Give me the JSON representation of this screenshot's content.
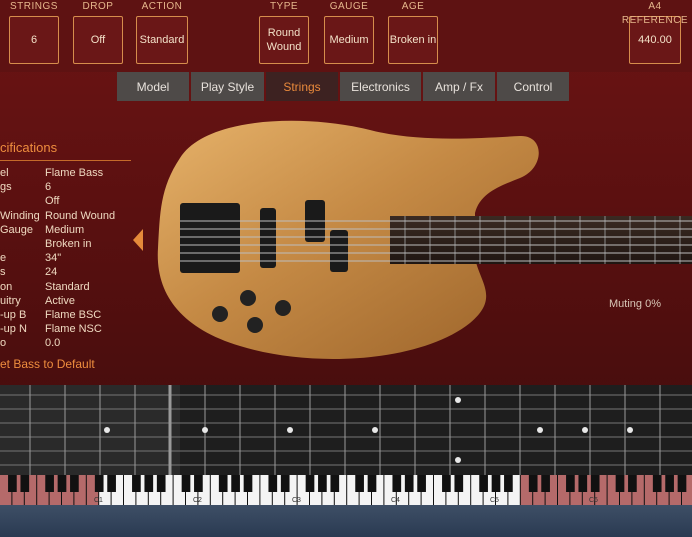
{
  "top_params": [
    {
      "label": "STRINGS",
      "value": "6"
    },
    {
      "label": "DROP",
      "value": "Off"
    },
    {
      "label": "ACTION",
      "value": "Standard"
    },
    {
      "label": "TYPE",
      "value": "Round Wound"
    },
    {
      "label": "GAUGE",
      "value": "Medium"
    },
    {
      "label": "AGE",
      "value": "Broken in"
    },
    {
      "label": "A4 REFERENCE",
      "value": "440.00"
    }
  ],
  "tabs": [
    {
      "label": "Model",
      "active": false
    },
    {
      "label": "Play Style",
      "active": false
    },
    {
      "label": "Strings",
      "active": true
    },
    {
      "label": "Electronics",
      "active": false
    },
    {
      "label": "Amp / Fx",
      "active": false
    },
    {
      "label": "Control",
      "active": false
    }
  ],
  "specs": {
    "title": "cifications",
    "rows": [
      {
        "key": "el",
        "value": "Flame Bass"
      },
      {
        "key": "gs",
        "value": "6"
      },
      {
        "key": "",
        "value": "Off"
      },
      {
        "key": "Winding",
        "value": "Round Wound"
      },
      {
        "key": "Gauge",
        "value": "Medium"
      },
      {
        "key": "",
        "value": "Broken in"
      },
      {
        "key": "e",
        "value": "34\""
      },
      {
        "key": "s",
        "value": "24"
      },
      {
        "key": "on",
        "value": "Standard"
      },
      {
        "key": "uitry",
        "value": "Active"
      },
      {
        "key": "-up B",
        "value": "Flame BSC"
      },
      {
        "key": "-up N",
        "value": "Flame NSC"
      },
      {
        "key": "o",
        "value": "0.0"
      }
    ],
    "reset_label": "et Bass to Default"
  },
  "muting": "Muting 0%",
  "piano_labels": [
    "C1",
    "C2",
    "C3",
    "C4",
    "C5",
    "C6"
  ],
  "colors": {
    "accent": "#e9893b",
    "background": "#5e1212",
    "wood": "#c98f4a"
  }
}
